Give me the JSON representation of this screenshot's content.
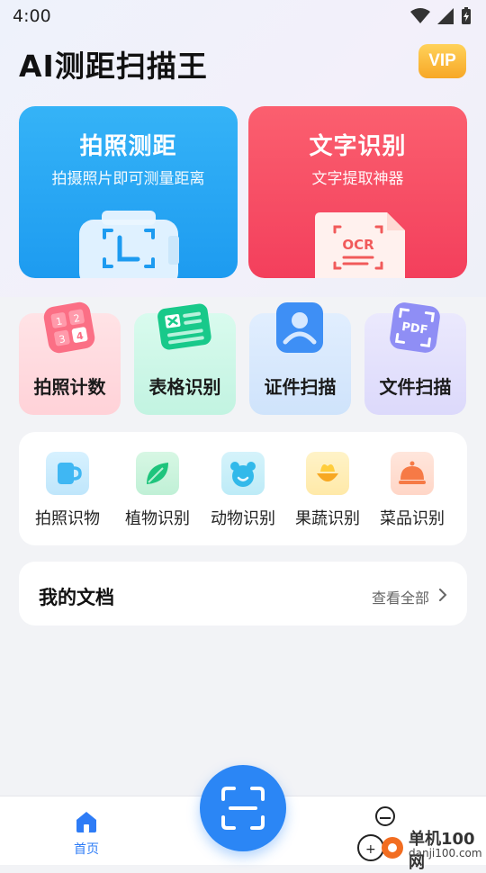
{
  "status": {
    "time": "4:00"
  },
  "header": {
    "title": "AI测距扫描王",
    "vip_label": "VIP"
  },
  "big_cards": [
    {
      "title": "拍照测距",
      "subtitle": "拍摄照片即可测量距离",
      "icon": "ruler-scan-icon"
    },
    {
      "title": "文字识别",
      "subtitle": "文字提取神器",
      "icon": "ocr-document-icon",
      "art_text": "OCR"
    }
  ],
  "features": [
    {
      "label": "拍照计数",
      "icon": "number-grid-icon",
      "digits": [
        "1",
        "2",
        "3",
        "4"
      ]
    },
    {
      "label": "表格识别",
      "icon": "spreadsheet-icon"
    },
    {
      "label": "证件扫描",
      "icon": "id-card-icon"
    },
    {
      "label": "文件扫描",
      "icon": "pdf-scan-icon",
      "art_text": "PDF"
    }
  ],
  "recognition": [
    {
      "label": "拍照识物",
      "icon": "cup-icon"
    },
    {
      "label": "植物识别",
      "icon": "leaf-icon"
    },
    {
      "label": "动物识别",
      "icon": "bear-icon"
    },
    {
      "label": "果蔬识别",
      "icon": "fruit-icon"
    },
    {
      "label": "菜品识别",
      "icon": "dish-cloche-icon"
    }
  ],
  "docs": {
    "title": "我的文档",
    "more_label": "查看全部"
  },
  "tabbar": {
    "home_label": "首页"
  },
  "watermark": {
    "brand": "单机100网",
    "url": "danji100.com"
  },
  "colors": {
    "accent": "#2b86f5",
    "blue_card": "#1d9bf0",
    "red_card": "#f33f5c",
    "vip": "#f7a726"
  }
}
